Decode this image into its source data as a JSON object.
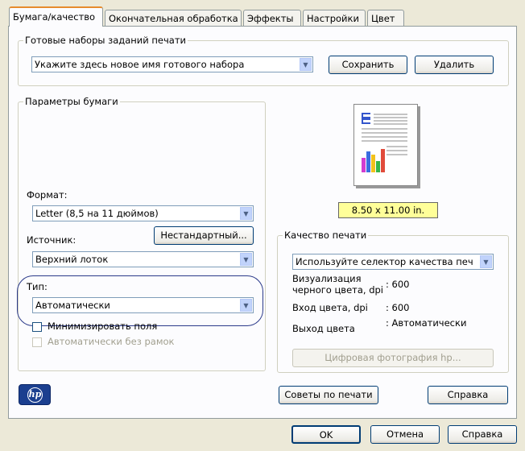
{
  "tabs": [
    "Бумага/качество",
    "Окончательная обработка",
    "Эффекты",
    "Настройки",
    "Цвет"
  ],
  "presets": {
    "legend": "Готовые наборы заданий печати",
    "combo_value": "Укажите здесь новое имя готового набора",
    "save_label": "Сохранить",
    "delete_label": "Удалить"
  },
  "paper": {
    "legend": "Параметры бумаги",
    "format_label": "Формат:",
    "format_value": "Letter (8,5 на 11 дюймов)",
    "source_label": "Источник:",
    "custom_button": "Нестандартный...",
    "source_value": "Верхний лоток",
    "type_label": "Тип:",
    "type_value": "Автоматически",
    "minimize_margins": "Минимизировать поля",
    "borderless": "Автоматически без рамок"
  },
  "preview": {
    "size_label": "8.50 x 11.00 in."
  },
  "quality": {
    "legend": "Качество печати",
    "combo_value": "Используйте селектор качества печ",
    "black_dpi_label": "Визуализация черного цвета, dpi",
    "black_dpi_value": ": 600",
    "color_dpi_label": "Вход цвета, dpi",
    "color_dpi_value": ": 600",
    "color_out_label": "Выход цвета",
    "color_out_value": ": Автоматически",
    "digital_photo_button": "Цифровая фотография hp..."
  },
  "bottom": {
    "logo_text": "hp",
    "tips_button": "Советы по печати",
    "help_button": "Справка"
  },
  "dialog": {
    "ok": "OK",
    "cancel": "Отмена",
    "help": "Справка"
  },
  "colors": {
    "tab_accent": "#e68b2c",
    "hp_logo_bg": "#1b3f8f",
    "size_badge_bg": "#ffff99"
  }
}
